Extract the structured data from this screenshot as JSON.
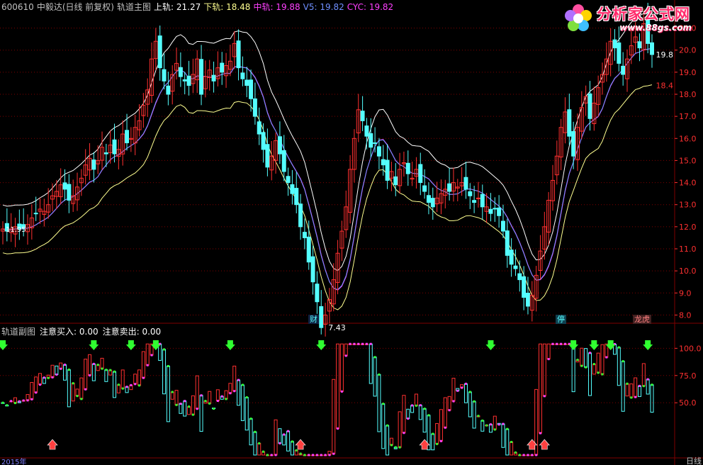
{
  "header": {
    "code": "600610",
    "name": "中毅达(日线 前复权)",
    "indicator": "轨道主图",
    "upper_label": "上轨: 21.27",
    "lower_label": "下轨: 18.48",
    "mid_label": "中轨: 19.88",
    "v5_label": "V5: 19.82",
    "cyc_label": "CYC: 19.82"
  },
  "sub_header": {
    "title": "轨道副图",
    "buy_label": "注意买入: 0.00",
    "sell_label": "注意卖出: 0.00"
  },
  "logo": {
    "name": "分析家公式网",
    "url": "www.88gs.com"
  },
  "tags": {
    "cai": "财",
    "ting": "停",
    "longhu": "龙虎"
  },
  "markers": {
    "low_price": "7.43",
    "last_close": "19.8",
    "last_lower": "18.4",
    "first_close": "11.95"
  },
  "footer": {
    "right_label": "日线",
    "left_fragment": "2015年"
  },
  "colors": {
    "up": "#ff3030",
    "down": "#54ffff",
    "upper_band": "#ffffff",
    "mid": "#ff40ff",
    "lower": "#ffff90",
    "grid": "#800000",
    "axis_text": "#ff3030",
    "green": "#30ff30"
  },
  "chart_data": [
    {
      "type": "candlestick",
      "title": "轨道主图",
      "ylim": [
        7.5,
        21.5
      ],
      "y_ticks": [
        "21.0",
        "20.0",
        "19.0",
        "18.0",
        "17.0",
        "16.0",
        "15.0",
        "14.0",
        "13.0",
        "12.0",
        "11.0",
        "10.0",
        "9.0",
        "8.0"
      ],
      "closes": [
        11.9,
        11.8,
        11.9,
        12.0,
        11.9,
        11.95,
        12.1,
        12.4,
        12.6,
        12.8,
        12.7,
        13.0,
        13.4,
        13.6,
        13.9,
        13.7,
        13.2,
        13.4,
        13.8,
        14.2,
        14.8,
        15.1,
        14.6,
        15.0,
        15.6,
        15.3,
        15.7,
        15.3,
        15.5,
        16.2,
        15.8,
        16.0,
        16.5,
        16.8,
        17.5,
        18.2,
        19.6,
        20.4,
        19.2,
        18.6,
        18.0,
        18.9,
        19.4,
        18.8,
        18.6,
        18.4,
        18.9,
        19.6,
        18.0,
        18.8,
        19.1,
        18.6,
        19.2,
        19.0,
        19.3,
        19.5,
        20.3,
        19.2,
        18.7,
        18.4,
        17.8,
        17.0,
        16.2,
        15.5,
        14.7,
        15.2,
        15.9,
        15.3,
        14.5,
        14.0,
        13.5,
        13.0,
        12.0,
        11.5,
        10.4,
        9.5,
        8.6,
        7.43,
        8.0,
        8.7,
        9.6,
        10.8,
        11.8,
        12.9,
        14.6,
        16.0,
        17.3,
        16.8,
        16.1,
        15.6,
        15.8,
        15.2,
        14.8,
        14.1,
        14.5,
        13.9,
        14.6,
        14.9,
        14.4,
        14.2,
        14.6,
        14.0,
        13.6,
        13.1,
        12.9,
        13.3,
        13.5,
        13.7,
        13.6,
        14.0,
        13.8,
        14.0,
        13.7,
        13.4,
        13.1,
        13.3,
        12.9,
        12.9,
        12.6,
        12.8,
        12.5,
        11.8,
        10.7,
        10.3,
        10.1,
        9.6,
        8.8,
        8.4,
        8.9,
        9.8,
        10.9,
        12.0,
        13.2,
        14.1,
        15.2,
        16.5,
        17.2,
        16.1,
        15.2,
        16.5,
        17.4,
        17.9,
        16.9,
        17.6,
        18.3,
        18.9,
        19.6,
        20.4,
        20.1,
        19.4,
        18.9,
        19.6,
        20.2,
        20.6,
        20.1,
        21.2,
        20.3,
        19.8
      ]
    },
    {
      "type": "line",
      "title": "轨道副图",
      "ylim": [
        0,
        110
      ],
      "y_ticks": [
        "100.0",
        "75.0",
        "50.0"
      ],
      "series": [
        {
          "name": "注意买入",
          "values": [
            0
          ]
        },
        {
          "name": "注意卖出",
          "values": [
            0
          ]
        }
      ]
    }
  ]
}
